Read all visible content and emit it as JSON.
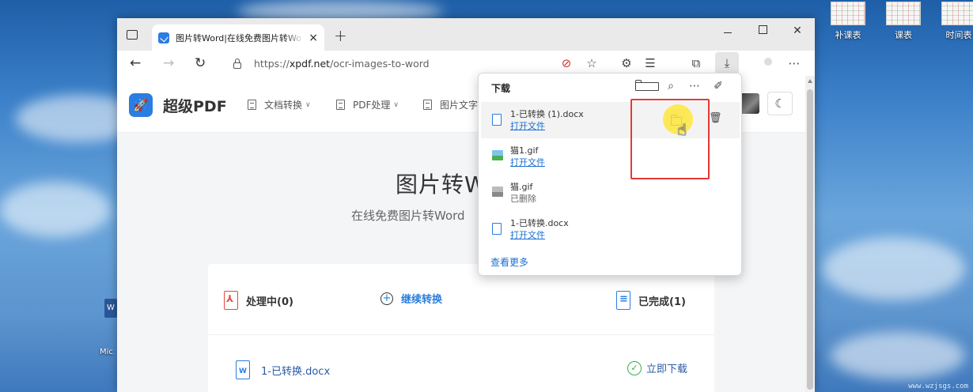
{
  "desktop": {
    "right_icons": [
      {
        "label": "补课表"
      },
      {
        "label": "课表"
      },
      {
        "label": "时间表"
      }
    ],
    "left_icon_label": "Mic",
    "watermark": "www.wzjsgs.com"
  },
  "browser": {
    "tab_title": "图片转Word|在线免费图片转Wo",
    "tab_close": "×",
    "new_tab": "+",
    "url_scheme": "https://",
    "url_host": "xpdf.net",
    "url_path": "/ocr-images-to-word"
  },
  "site": {
    "logo": "超级PDF",
    "nav": [
      {
        "label": "文档转换"
      },
      {
        "label": "PDF处理"
      },
      {
        "label": "图片文字"
      }
    ],
    "hero_title": "图片转Word",
    "hero_subtitle": "在线免费图片转Word",
    "panel": {
      "processing": "处理中(0)",
      "continue": "继续转换",
      "completed": "已完成(1)",
      "file_name": "1-已转换.docx",
      "download_now": "立即下载"
    }
  },
  "downloads": {
    "title": "下载",
    "items": [
      {
        "name": "1-已转换 (1).docx",
        "action": "打开文件",
        "kind": "docx"
      },
      {
        "name": "猫1.gif",
        "action": "打开文件",
        "kind": "image"
      },
      {
        "name": "猫.gif",
        "action": "已删除",
        "kind": "deleted"
      },
      {
        "name": "1-已转换.docx",
        "action": "打开文件",
        "kind": "docx"
      }
    ],
    "see_more": "查看更多"
  },
  "colors": {
    "accent": "#2a7de1",
    "link": "#1a6fd1",
    "highlight": "#e53935",
    "pdf_red": "#e04b3a",
    "success": "#2fb34a"
  }
}
